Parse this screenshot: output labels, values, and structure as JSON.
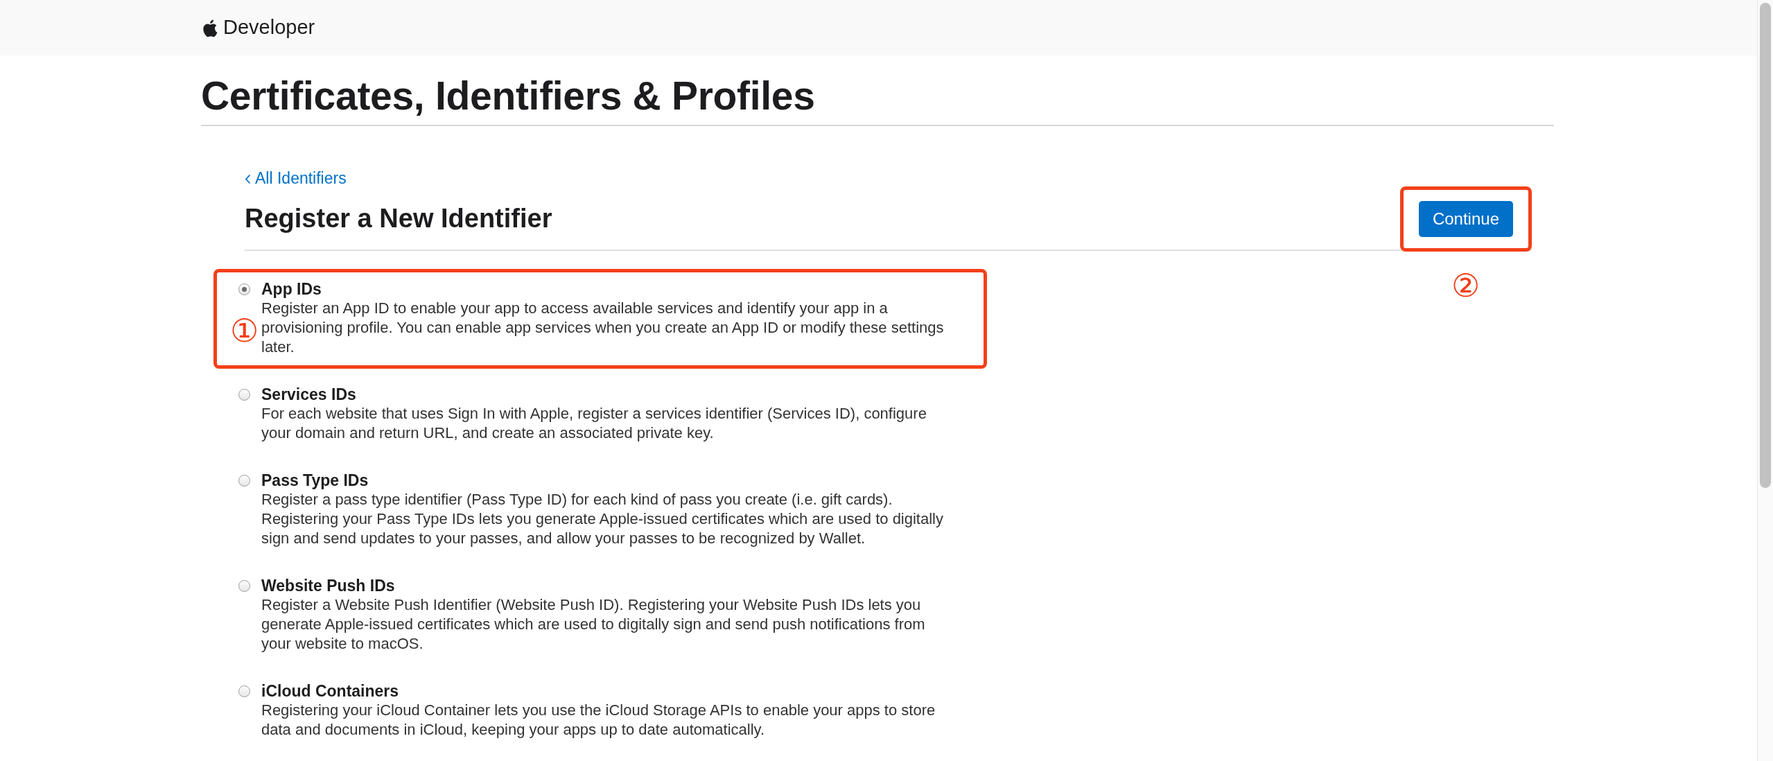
{
  "header": {
    "brand": "Developer"
  },
  "page_title": "Certificates, Identifiers & Profiles",
  "back_link": {
    "label": "All Identifiers"
  },
  "section_title": "Register a New Identifier",
  "continue_button": {
    "label": "Continue",
    "highlighted": true,
    "annotation": "②"
  },
  "options": [
    {
      "title": "App IDs",
      "description": "Register an App ID to enable your app to access available services and identify your app in a provisioning profile. You can enable app services when you create an App ID or modify these settings later.",
      "selected": true,
      "highlighted": true,
      "annotation": "①"
    },
    {
      "title": "Services IDs",
      "description": "For each website that uses Sign In with Apple, register a services identifier (Services ID), configure your domain and return URL, and create an associated private key.",
      "selected": false,
      "highlighted": false
    },
    {
      "title": "Pass Type IDs",
      "description": "Register a pass type identifier (Pass Type ID) for each kind of pass you create (i.e. gift cards). Registering your Pass Type IDs lets you generate Apple-issued certificates which are used to digitally sign and send updates to your passes, and allow your passes to be recognized by Wallet.",
      "selected": false,
      "highlighted": false
    },
    {
      "title": "Website Push IDs",
      "description": "Register a Website Push Identifier (Website Push ID). Registering your Website Push IDs lets you generate Apple-issued certificates which are used to digitally sign and send push notifications from your website to macOS.",
      "selected": false,
      "highlighted": false
    },
    {
      "title": "iCloud Containers",
      "description": "Registering your iCloud Container lets you use the iCloud Storage APIs to enable your apps to store data and documents in iCloud, keeping your apps up to date automatically.",
      "selected": false,
      "highlighted": false
    }
  ]
}
